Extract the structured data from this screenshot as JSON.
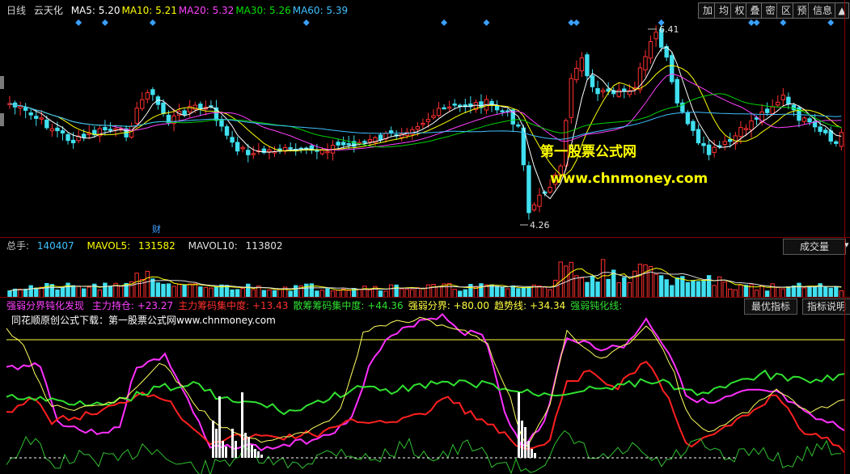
{
  "header": {
    "period": "日线",
    "stock": "云天化",
    "ma": [
      {
        "label": "MA5:",
        "value": "5.20",
        "color": "#ffffff"
      },
      {
        "label": "MA10:",
        "value": "5.21",
        "color": "#ffff00"
      },
      {
        "label": "MA20:",
        "value": "5.32",
        "color": "#ff40ff"
      },
      {
        "label": "MA30:",
        "value": "5.26",
        "color": "#00e000"
      },
      {
        "label": "MA60:",
        "value": "5.39",
        "color": "#40c0ff"
      }
    ]
  },
  "toolbar": {
    "buttons": [
      "加",
      "均",
      "权",
      "叠",
      "密",
      "区",
      "预",
      "信息",
      "▲"
    ]
  },
  "price_chart": {
    "high_label": "6.41",
    "low_label": "4.26",
    "event_marker": "财",
    "watermark_line1": "第一股票公式网",
    "watermark_line2": "www.chnmoney.com",
    "colors": {
      "up": "#ff3030",
      "down": "#40e0f0",
      "diamond": "#3aa0ff"
    }
  },
  "volume_panel": {
    "label": "总手:",
    "value": "140407",
    "mavol5_label": "MAVOL5:",
    "mavol5_value": "131582",
    "mavol10_label": "MAVOL10:",
    "mavol10_value": "113802",
    "dropdown": "成交量",
    "dropdown_arrow": "▾"
  },
  "indicator_panel": {
    "title": "强弱分界钝化发现",
    "items": [
      {
        "label": "主力持仓:",
        "value": "+23.27",
        "color": "#ff40ff"
      },
      {
        "label": "主力筹码集中度:",
        "value": "+13.43",
        "color": "#ff3030"
      },
      {
        "label": "散筹筹码集中度:",
        "value": "+44.36",
        "color": "#30e030"
      },
      {
        "label": "强弱分界:",
        "value": "+80.00",
        "color": "#ffff40"
      },
      {
        "label": "趋势线:",
        "value": "+34.34",
        "color": "#ffff40"
      },
      {
        "label": "强弱钝化线:",
        "value": "",
        "color": "#30e030"
      }
    ],
    "subtitle": "同花顺原创公式下载：第一股票公式网www.chnmoney.com",
    "btn_best": "最优指标",
    "btn_explain": "指标说明"
  }
}
